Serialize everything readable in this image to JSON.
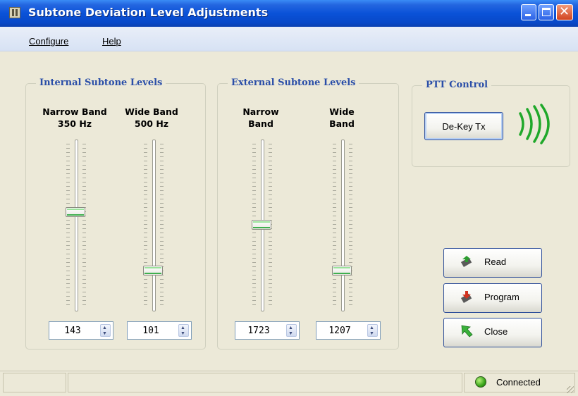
{
  "window": {
    "title": "Subtone Deviation Level Adjustments",
    "controls": {
      "minimize": "minimize",
      "maximize": "maximize",
      "close_glyph": "✕"
    }
  },
  "menu": [
    "Configure",
    "Help"
  ],
  "internal": {
    "label": "Internal Subtone Levels",
    "narrow": {
      "line1": "Narrow Band",
      "line2": "350 Hz",
      "value": "143"
    },
    "wide": {
      "line1": "Wide Band",
      "line2": "500 Hz",
      "value": "101"
    }
  },
  "external": {
    "label": "External Subtone Levels",
    "narrow": {
      "line1": "Narrow",
      "line2": "Band",
      "value": "1723"
    },
    "wide": {
      "line1": "Wide",
      "line2": "Band",
      "value": "1207"
    }
  },
  "ptt": {
    "label": "PTT Control",
    "button": "De-Key Tx",
    "signal_icon": "radio-waves-icon",
    "signal_color": "#1fa82a"
  },
  "buttons": {
    "read": "Read",
    "program": "Program",
    "close": "Close"
  },
  "status": {
    "text": "Connected",
    "led_color": "#3aa51b"
  }
}
